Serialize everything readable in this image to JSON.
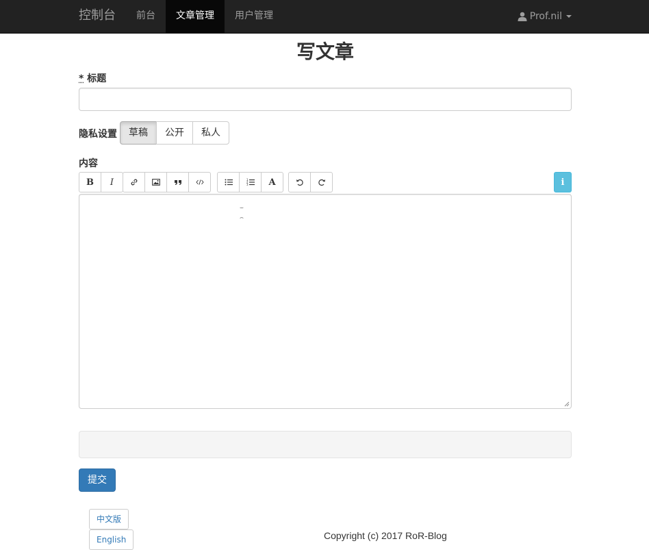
{
  "navbar": {
    "brand": "控制台",
    "links": [
      {
        "label": "前台",
        "active": false
      },
      {
        "label": "文章管理",
        "active": true
      },
      {
        "label": "用户管理",
        "active": false
      }
    ],
    "user": "Prof.nil"
  },
  "form": {
    "heading": "写文章",
    "title_required_mark": "*",
    "title_label": "标题",
    "title_value": "",
    "privacy_label": "隐私设置",
    "privacy_options": [
      "草稿",
      "公开",
      "私人"
    ],
    "privacy_selected": "草稿",
    "content_label": "内容",
    "editor_toolbar": {
      "groups": [
        [
          "bold-icon",
          "italic-icon"
        ],
        [
          "link-icon",
          "image-icon",
          "quote-icon",
          "code-icon"
        ],
        [
          "unordered-list-icon",
          "ordered-list-icon",
          "heading-icon"
        ],
        [
          "undo-icon",
          "redo-icon"
        ]
      ],
      "info_icon": "info-icon"
    },
    "content_value": "",
    "submit_label": "提交"
  },
  "footer": {
    "languages": [
      "中文版",
      "English"
    ],
    "copyright": "Copyright (c) 2017 RoR-Blog"
  },
  "colors": {
    "navbar_bg": "#222222",
    "primary": "#337ab7",
    "info": "#5bc0de"
  }
}
